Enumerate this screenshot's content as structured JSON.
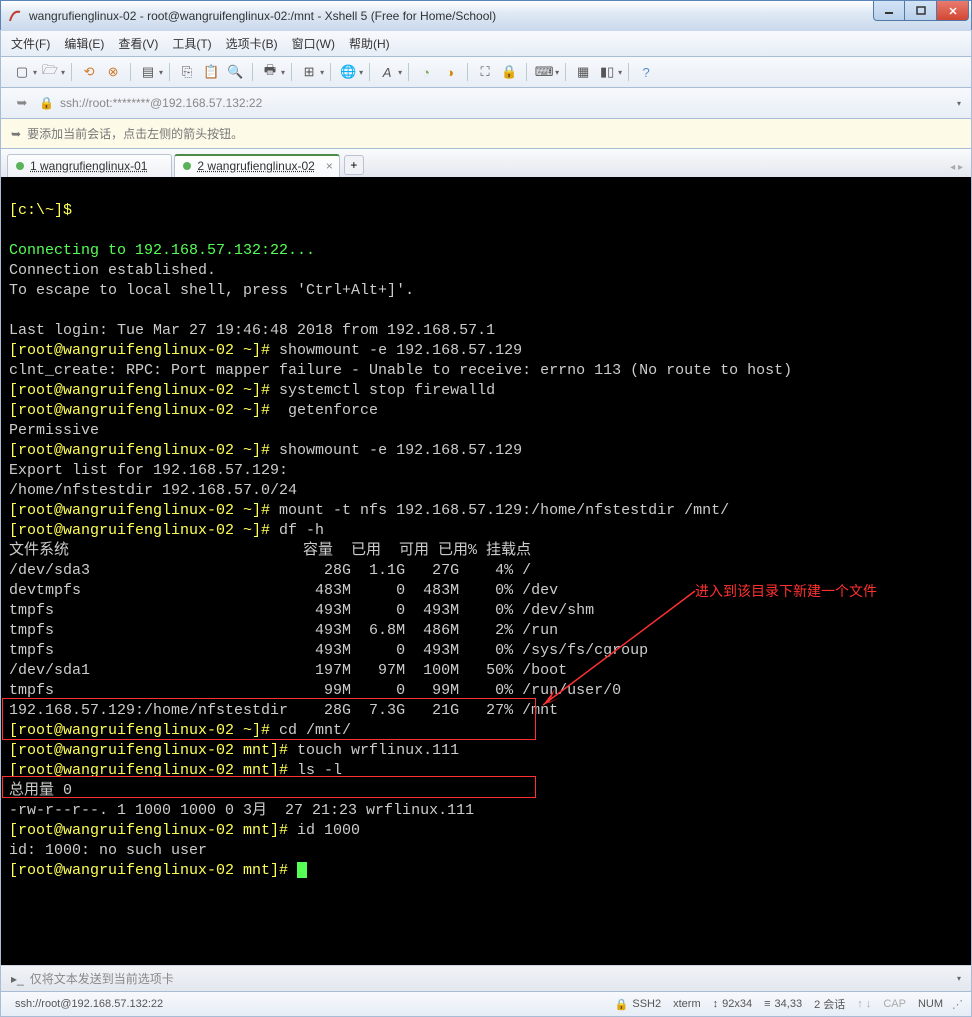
{
  "window": {
    "title": "wangrufienglinux-02 - root@wangruifenglinux-02:/mnt - Xshell 5 (Free for Home/School)"
  },
  "menu": {
    "file": "文件(F)",
    "edit": "编辑(E)",
    "view": "查看(V)",
    "tools": "工具(T)",
    "tabs": "选项卡(B)",
    "window": "窗口(W)",
    "help": "帮助(H)"
  },
  "address": {
    "url": "ssh://root:********@192.168.57.132:22"
  },
  "info": {
    "text": "要添加当前会话，点击左侧的箭头按钮。"
  },
  "tabs": {
    "t1": "1 wangrufienglinux-01",
    "t2": "2 wangrufienglinux-02",
    "close": "×",
    "new": "+"
  },
  "terminal": {
    "l1_prompt": "[c:\\~]$ ",
    "l2": "",
    "l3": "Connecting to 192.168.57.132:22...",
    "l4": "Connection established.",
    "l5": "To escape to local shell, press 'Ctrl+Alt+]'.",
    "l6": "",
    "l7": "Last login: Tue Mar 27 19:46:48 2018 from 192.168.57.1",
    "l8p": "[root@wangruifenglinux-02 ~]# ",
    "l8c": "showmount -e 192.168.57.129",
    "l9": "clnt_create: RPC: Port mapper failure - Unable to receive: errno 113 (No route to host)",
    "l10p": "[root@wangruifenglinux-02 ~]# ",
    "l10c": "systemctl stop firewalld",
    "l11p": "[root@wangruifenglinux-02 ~]# ",
    "l11c": " getenforce",
    "l12": "Permissive",
    "l13p": "[root@wangruifenglinux-02 ~]# ",
    "l13c": "showmount -e 192.168.57.129",
    "l14": "Export list for 192.168.57.129:",
    "l15": "/home/nfstestdir 192.168.57.0/24",
    "l16p": "[root@wangruifenglinux-02 ~]# ",
    "l16c": "mount -t nfs 192.168.57.129:/home/nfstestdir /mnt/",
    "l17p": "[root@wangruifenglinux-02 ~]# ",
    "l17c": "df -h",
    "l18": "文件系统                          容量  已用  可用 已用% 挂载点",
    "l19": "/dev/sda3                          28G  1.1G   27G    4% /",
    "l20": "devtmpfs                          483M     0  483M    0% /dev",
    "l21": "tmpfs                             493M     0  493M    0% /dev/shm",
    "l22": "tmpfs                             493M  6.8M  486M    2% /run",
    "l23": "tmpfs                             493M     0  493M    0% /sys/fs/cgroup",
    "l24": "/dev/sda1                         197M   97M  100M   50% /boot",
    "l25": "tmpfs                              99M     0   99M    0% /run/user/0",
    "l26": "192.168.57.129:/home/nfstestdir    28G  7.3G   21G   27% /mnt",
    "l27p": "[root@wangruifenglinux-02 ~]# ",
    "l27c": "cd /mnt/",
    "l28p": "[root@wangruifenglinux-02 mnt]# ",
    "l28c": "touch wrflinux.111",
    "l29p": "[root@wangruifenglinux-02 mnt]# ",
    "l29c": "ls -l",
    "l30": "总用量 0",
    "l31": "-rw-r--r--. 1 1000 1000 0 3月  27 21:23 wrflinux.111",
    "l32p": "[root@wangruifenglinux-02 mnt]# ",
    "l32c": "id 1000",
    "l33": "id: 1000: no such user",
    "l34p": "[root@wangruifenglinux-02 mnt]# "
  },
  "annotation": {
    "note": "进入到该目录下新建一个文件"
  },
  "sendbar": {
    "text": "仅将文本发送到当前选项卡"
  },
  "status": {
    "conn": "ssh://root@192.168.57.132:22",
    "proto": "SSH2",
    "term": "xterm",
    "size": "92x34",
    "pos": "34,33",
    "sessions": "2 会话",
    "cap": "CAP",
    "num": "NUM"
  }
}
